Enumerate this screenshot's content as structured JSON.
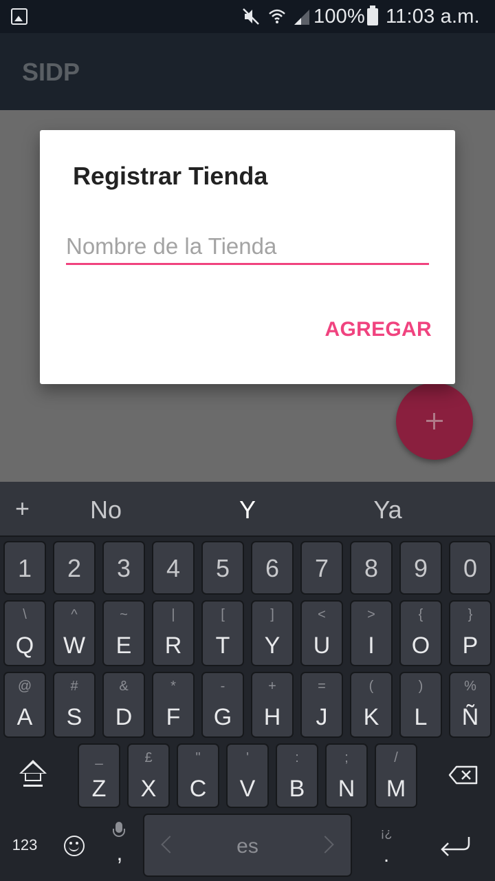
{
  "status_bar": {
    "battery": "100%",
    "time": "11:03 a.m."
  },
  "app_bar": {
    "title": "SIDP"
  },
  "dialog": {
    "title": "Registrar Tienda",
    "input_placeholder": "Nombre de la Tienda",
    "input_value": "",
    "add_label": "AGREGAR"
  },
  "colors": {
    "accent": "#f0437f",
    "app_bar": "#1b222b",
    "status_bar": "#121821",
    "fab": "#8a1f3e",
    "keyboard": "#22252b"
  },
  "keyboard": {
    "suggestions": [
      "No",
      "Y",
      "Ya"
    ],
    "number_row": [
      "1",
      "2",
      "3",
      "4",
      "5",
      "6",
      "7",
      "8",
      "9",
      "0"
    ],
    "row1": [
      {
        "sub": "\\",
        "main": "Q"
      },
      {
        "sub": "^",
        "main": "W"
      },
      {
        "sub": "~",
        "main": "E"
      },
      {
        "sub": "|",
        "main": "R"
      },
      {
        "sub": "[",
        "main": "T"
      },
      {
        "sub": "]",
        "main": "Y"
      },
      {
        "sub": "<",
        "main": "U"
      },
      {
        "sub": ">",
        "main": "I"
      },
      {
        "sub": "{",
        "main": "O"
      },
      {
        "sub": "}",
        "main": "P"
      }
    ],
    "row2": [
      {
        "sub": "@",
        "main": "A"
      },
      {
        "sub": "#",
        "main": "S"
      },
      {
        "sub": "&",
        "main": "D"
      },
      {
        "sub": "*",
        "main": "F"
      },
      {
        "sub": "-",
        "main": "G"
      },
      {
        "sub": "+",
        "main": "H"
      },
      {
        "sub": "=",
        "main": "J"
      },
      {
        "sub": "(",
        "main": "K"
      },
      {
        "sub": ")",
        "main": "L"
      },
      {
        "sub": "%",
        "main": "Ñ"
      }
    ],
    "row3": [
      {
        "sub": "_",
        "main": "Z"
      },
      {
        "sub": "£",
        "main": "X"
      },
      {
        "sub": "\"",
        "main": "C"
      },
      {
        "sub": "'",
        "main": "V"
      },
      {
        "sub": ":",
        "main": "B"
      },
      {
        "sub": ";",
        "main": "N"
      },
      {
        "sub": "/",
        "main": "M"
      }
    ],
    "num_mode": "123",
    "comma": ",",
    "space_label": "es",
    "period_sub": "¡¿",
    "period": ".",
    "icons": {
      "shift": "shift-icon",
      "backspace": "backspace-icon",
      "emoji": "emoji-icon",
      "mic": "mic-icon",
      "enter": "enter-icon",
      "add": "plus-icon"
    }
  }
}
